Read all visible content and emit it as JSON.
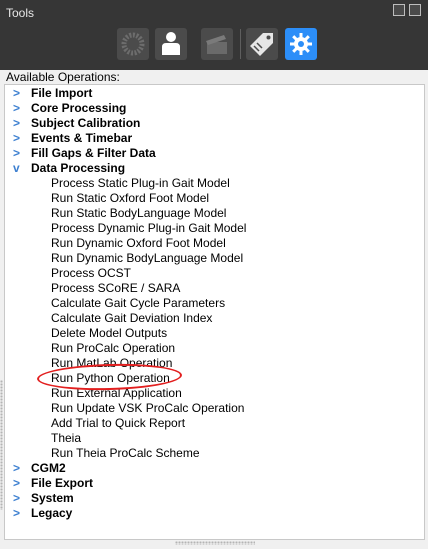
{
  "panel": {
    "title": "Tools",
    "toolbar": [
      {
        "name": "pipeline-tools-icon",
        "state": "disabled"
      },
      {
        "name": "subject-icon",
        "state": "normal"
      },
      {
        "name": "clapper-icon",
        "state": "disabled"
      },
      {
        "name": "label-tag-icon",
        "state": "normal"
      },
      {
        "name": "gear-icon",
        "state": "active"
      }
    ],
    "accent_color": "#2c8ef8",
    "annotation_color": "#e21f1f"
  },
  "operations": {
    "label": "Available Operations:",
    "categories": [
      {
        "label": "File Import",
        "expanded": false
      },
      {
        "label": "Core Processing",
        "expanded": false
      },
      {
        "label": "Subject Calibration",
        "expanded": false
      },
      {
        "label": "Events & Timebar",
        "expanded": false
      },
      {
        "label": "Fill Gaps & Filter Data",
        "expanded": false
      },
      {
        "label": "Data Processing",
        "expanded": true
      },
      {
        "label": "CGM2",
        "expanded": false
      },
      {
        "label": "File Export",
        "expanded": false
      },
      {
        "label": "System",
        "expanded": false
      },
      {
        "label": "Legacy",
        "expanded": false
      }
    ],
    "data_processing_items": [
      "Process Static Plug-in Gait Model",
      "Run Static Oxford Foot Model",
      "Run Static BodyLanguage Model",
      "Process Dynamic Plug-in Gait Model",
      "Run Dynamic Oxford Foot Model",
      "Run Dynamic BodyLanguage Model",
      "Process OCST",
      "Process SCoRE / SARA",
      "Calculate Gait Cycle Parameters",
      "Calculate Gait Deviation Index",
      "Delete Model Outputs",
      "Run ProCalc Operation",
      "Run MatLab Operation",
      "Run Python Operation",
      "Run External Application",
      "Run Update VSK ProCalc Operation",
      "Add Trial to Quick Report",
      "Theia",
      "Run Theia ProCalc Scheme"
    ],
    "glyph_collapsed": ">",
    "glyph_expanded": "v"
  }
}
